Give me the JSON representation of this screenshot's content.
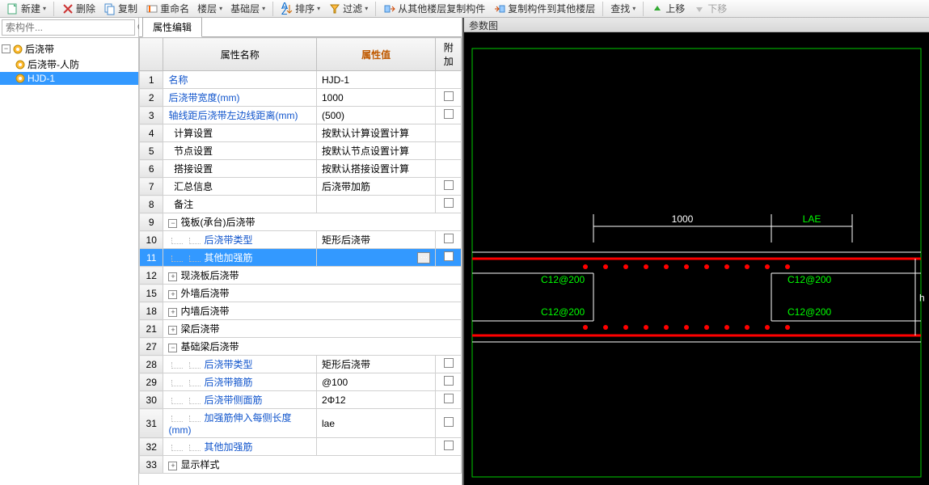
{
  "toolbar": {
    "new": "新建",
    "delete": "删除",
    "copy": "复制",
    "rename": "重命名",
    "floor": "楼层",
    "foundation": "基础层",
    "sort": "排序",
    "filter": "过滤",
    "copy_from_other": "从其他楼层复制构件",
    "copy_to_other": "复制构件到其他楼层",
    "find": "查找",
    "up": "上移",
    "down": "下移"
  },
  "search": {
    "placeholder": "索构件..."
  },
  "tree": {
    "root": "后浇带",
    "child1": "后浇带-人防",
    "child2": "HJD-1"
  },
  "tab": "属性编辑",
  "grid_headers": {
    "name": "属性名称",
    "value": "属性值",
    "add": "附加"
  },
  "rows": [
    {
      "n": 1,
      "name": "名称",
      "value": "HJD-1",
      "link": true,
      "add": null
    },
    {
      "n": 2,
      "name": "后浇带宽度(mm)",
      "value": "1000",
      "link": true,
      "add": true
    },
    {
      "n": 3,
      "name": "轴线距后浇带左边线距离(mm)",
      "value": "(500)",
      "link": true,
      "add": true
    },
    {
      "n": 4,
      "name": "计算设置",
      "value": "按默认计算设置计算",
      "indent": 1,
      "add": null
    },
    {
      "n": 5,
      "name": "节点设置",
      "value": "按默认节点设置计算",
      "indent": 1,
      "add": null
    },
    {
      "n": 6,
      "name": "搭接设置",
      "value": "按默认搭接设置计算",
      "indent": 1,
      "add": null
    },
    {
      "n": 7,
      "name": "汇总信息",
      "value": "后浇带加筋",
      "indent": 1,
      "add": true
    },
    {
      "n": 8,
      "name": "备注",
      "value": "",
      "indent": 1,
      "add": true
    },
    {
      "n": 9,
      "name": "筏板(承台)后浇带",
      "group": true,
      "expand": "-"
    },
    {
      "n": 10,
      "name": "后浇带类型",
      "value": "矩形后浇带",
      "indent": 2,
      "link": true,
      "add": true
    },
    {
      "n": 11,
      "name": "其他加强筋",
      "value": "",
      "indent": 2,
      "link": true,
      "add": true,
      "selected": true,
      "ellipsis": true
    },
    {
      "n": 12,
      "name": "现浇板后浇带",
      "group": true,
      "expand": "+"
    },
    {
      "n": 15,
      "name": "外墙后浇带",
      "group": true,
      "expand": "+"
    },
    {
      "n": 18,
      "name": "内墙后浇带",
      "group": true,
      "expand": "+"
    },
    {
      "n": 21,
      "name": "梁后浇带",
      "group": true,
      "expand": "+"
    },
    {
      "n": 27,
      "name": "基础梁后浇带",
      "group": true,
      "expand": "-"
    },
    {
      "n": 28,
      "name": "后浇带类型",
      "value": "矩形后浇带",
      "indent": 2,
      "link": true,
      "add": true
    },
    {
      "n": 29,
      "name": "后浇带箍筋",
      "value": "@100",
      "indent": 2,
      "link": true,
      "add": true
    },
    {
      "n": 30,
      "name": "后浇带侧面筋",
      "value": "2Φ12",
      "indent": 2,
      "link": true,
      "add": true
    },
    {
      "n": 31,
      "name": "加强筋伸入每侧长度(mm)",
      "value": "lae",
      "indent": 2,
      "link": true,
      "add": true
    },
    {
      "n": 32,
      "name": "其他加强筋",
      "value": "",
      "indent": 2,
      "link": true,
      "add": true
    },
    {
      "n": 33,
      "name": "显示样式",
      "group": true,
      "expand": "+"
    }
  ],
  "right_title": "参数图",
  "chart_data": {
    "type": "diagram",
    "dimension_top": "1000",
    "extension_label": "LAE",
    "height_label": "h",
    "rebar_labels": [
      "C12@200",
      "C12@200",
      "C12@200",
      "C12@200"
    ]
  }
}
